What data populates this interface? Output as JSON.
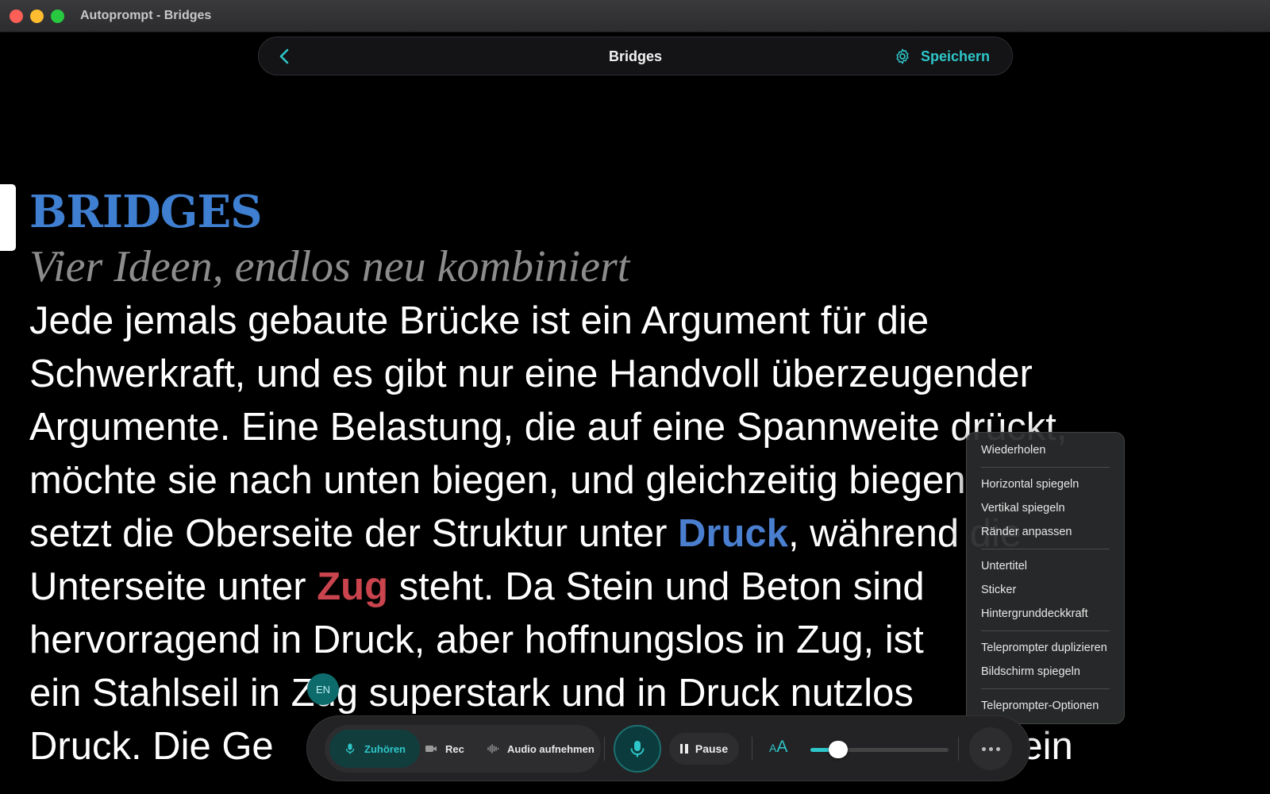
{
  "window": {
    "title": "Autoprompt - Bridges"
  },
  "topbar": {
    "title": "Bridges",
    "save_label": "Speichern"
  },
  "script": {
    "title": "BRIDGES",
    "subtitle": "Vier Ideen, endlos neu kombiniert",
    "lines": [
      [
        "Jede jemals gebaute Brücke ist ein Argument für die"
      ],
      [
        "Schwerkraft, und es gibt nur eine Handvoll überzeugender"
      ],
      [
        "Argumente. Eine Belastung, die auf eine Spannweite drückt,"
      ],
      [
        "möchte sie nach unten biegen, und gleichzeitig biegen"
      ],
      [
        "setzt die Oberseite der Struktur unter ",
        "Druck",
        ", während die"
      ],
      [
        "Unterseite unter ",
        "Zug",
        " steht. Da Stein und Beton sind"
      ],
      [
        "hervorragend in Druck, aber hoffnungslos in Zug, ist"
      ],
      [
        "ein Stahlseil in Zug superstark und in Druck nutzlos"
      ],
      [
        "Druck. Die Ge",
        "",
        "aber ein"
      ]
    ],
    "keyword_druck": "Druck",
    "keyword_zug": "Zug"
  },
  "lang_badge": "EN",
  "menu": {
    "groups": [
      [
        "Wiederholen"
      ],
      [
        "Horizontal spiegeln",
        "Vertikal spiegeln",
        "Ränder anpassen"
      ],
      [
        "Untertitel",
        "Sticker",
        "Hintergrunddeckkraft"
      ],
      [
        "Teleprompter duplizieren",
        "Bildschirm spiegeln"
      ],
      [
        "Teleprompter-Optionen"
      ]
    ]
  },
  "controls": {
    "listen_label": "Zuhören",
    "rec_label": "Rec",
    "audio_label": "Audio aufnehmen",
    "pause_label": "Pause",
    "font_size_label": "AA",
    "font_size_level": 0.15
  },
  "colors": {
    "accent": "#2ec6c9",
    "title_blue": "#3f7fd1",
    "keyword_red": "#c9444d"
  }
}
